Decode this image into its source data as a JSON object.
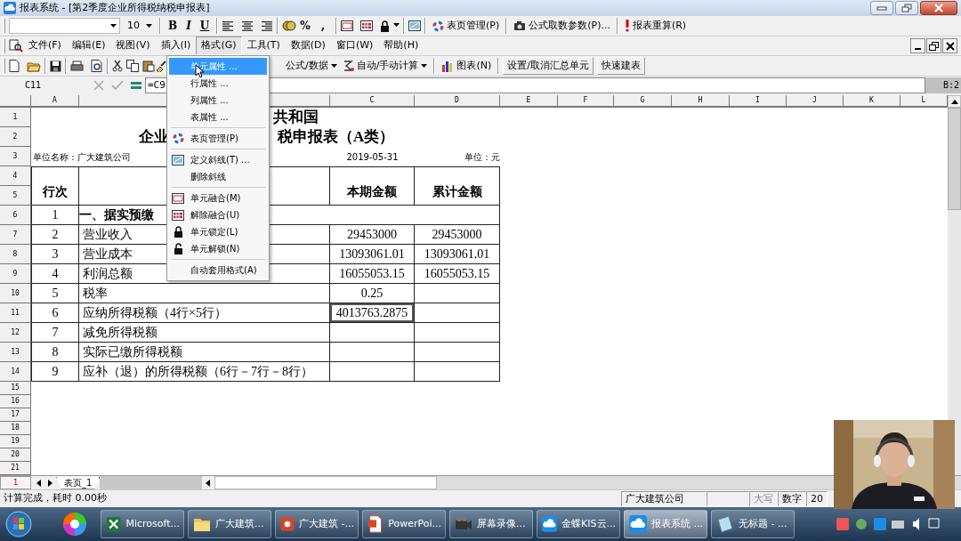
{
  "title_bar": {
    "title": "报表系统 - [第2季度企业所得税纳税申报表]"
  },
  "format_toolbar": {
    "font_size": "10",
    "style_buttons": [
      "B",
      "I",
      "U"
    ],
    "number_buttons": [
      "%",
      ","
    ],
    "commands": [
      "表页管理(P)",
      "公式取数参数(P)...",
      "报表重算(R)"
    ]
  },
  "menu_bar": {
    "items": [
      {
        "label": "文件(F)",
        "selected": false
      },
      {
        "label": "编辑(E)",
        "selected": false
      },
      {
        "label": "视图(V)",
        "selected": false
      },
      {
        "label": "插入(I)",
        "selected": false
      },
      {
        "label": "格式(G)",
        "selected": true
      },
      {
        "label": "工具(T)",
        "selected": false
      },
      {
        "label": "数据(D)",
        "selected": false
      },
      {
        "label": "窗口(W)",
        "selected": false
      },
      {
        "label": "帮助(H)",
        "selected": false
      }
    ]
  },
  "format_menu": {
    "items": [
      {
        "label": "单元属性 ...",
        "selected": true,
        "separator_after": false
      },
      {
        "label": "行属性 ...",
        "selected": false,
        "separator_after": false
      },
      {
        "label": "列属性 ...",
        "selected": false,
        "separator_after": false
      },
      {
        "label": "表属性 ...",
        "selected": false,
        "separator_after": true
      },
      {
        "label": "表页管理(P)",
        "selected": false,
        "separator_after": true
      },
      {
        "label": "定义斜线(T) ...",
        "selected": false,
        "separator_after": false
      },
      {
        "label": "删除斜线",
        "selected": false,
        "separator_after": true
      },
      {
        "label": "单元融合(M)",
        "selected": false,
        "separator_after": false
      },
      {
        "label": "解除融合(U)",
        "selected": false,
        "separator_after": false
      },
      {
        "label": "单元锁定(L)",
        "selected": false,
        "separator_after": false
      },
      {
        "label": "单元解锁(N)",
        "selected": false,
        "separator_after": true
      },
      {
        "label": "自动套用格式(A)",
        "selected": false,
        "separator_after": false
      }
    ]
  },
  "standard_toolbar": {
    "commands": [
      {
        "label": "公式/数据",
        "kind": "dropdown"
      },
      {
        "label": "自动/手动计算",
        "kind": "dropdown"
      },
      {
        "label": "图表(N)",
        "kind": "chart"
      },
      {
        "label": "设置/取消汇总单元",
        "kind": "plain"
      },
      {
        "label": "快速建表",
        "kind": "plain"
      }
    ]
  },
  "formula_bar": {
    "cell": "C11",
    "formula": "=C9",
    "sheet_position": "B:2"
  },
  "sheet": {
    "columns": [
      "A",
      "C",
      "D",
      "E",
      "F",
      "G",
      "H",
      "I",
      "J",
      "K",
      "L"
    ],
    "row_numbers": [
      "1",
      "2",
      "3",
      "4",
      "5",
      "6",
      "7",
      "8",
      "9",
      "10",
      "11",
      "12",
      "13",
      "14",
      "15",
      "16",
      "17",
      "18",
      "19",
      "20",
      "21"
    ],
    "title_line_1": [
      "共和国"
    ],
    "title_line_2": [
      "企业",
      "税申报表（A类）"
    ],
    "company": "单位名称：广大建筑公司",
    "date": "2019-05-31",
    "unit": "单位：元",
    "headers": [
      "行次",
      "本期金额",
      "累计金额"
    ],
    "section": {
      "no": "1",
      "label": "一、据实预缴"
    },
    "rows": [
      {
        "no": "2",
        "item": "营业收入",
        "current": "29453000",
        "cumulative": "29453000",
        "selected": false
      },
      {
        "no": "3",
        "item": "营业成本",
        "current": "13093061.01",
        "cumulative": "13093061.01",
        "selected": false
      },
      {
        "no": "4",
        "item": "利润总额",
        "current": "16055053.15",
        "cumulative": "16055053.15",
        "selected": false
      },
      {
        "no": "5",
        "item": "税率",
        "current": "0.25",
        "selected": false
      },
      {
        "no": "6",
        "item": "应纳所得税额（4行×5行）",
        "current": "4013763.2875",
        "selected": true
      },
      {
        "no": "7",
        "item": "减免所得税额",
        "selected": false
      },
      {
        "no": "8",
        "item": "实际已缴所得税额",
        "selected": false
      },
      {
        "no": "9",
        "item": "应补（退）的所得税额（6行－7行－8行）",
        "selected": false
      }
    ]
  },
  "sheet_tabs": {
    "page": "1",
    "tabs": [
      {
        "label": "表页_1",
        "selected": true
      }
    ]
  },
  "status_bar": {
    "message": "计算完成，耗时 0.00秒",
    "company": "广大建筑公司",
    "indicators": [
      {
        "text": "大写",
        "on": false
      },
      {
        "text": "数字",
        "on": true
      },
      {
        "text": "20",
        "on": true
      }
    ]
  },
  "taskbar": {
    "items": [
      {
        "label": "Microsoft...",
        "selected": false
      },
      {
        "label": "广大建筑...",
        "selected": false
      },
      {
        "label": "广大建筑 -...",
        "selected": false
      },
      {
        "label": "PowerPoi...",
        "selected": false
      },
      {
        "label": "屏幕录像...",
        "selected": false
      },
      {
        "label": "金蝶KIS云...",
        "selected": false
      },
      {
        "label": "报表系统 ...",
        "selected": true
      },
      {
        "label": "无标题 - ...",
        "selected": false
      }
    ]
  }
}
